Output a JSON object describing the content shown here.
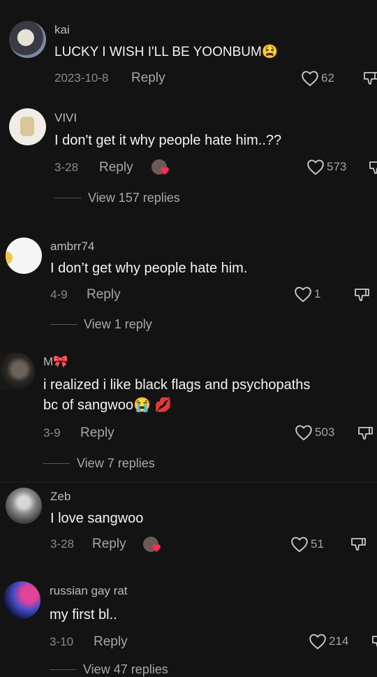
{
  "comments": [
    {
      "username": "kai",
      "text": "LUCKY I WISH I'LL BE YOONBUM",
      "emoji": "😫",
      "date": "2023-10-8",
      "reply": "Reply",
      "likes": "62"
    },
    {
      "username": "VIVI",
      "text": "I don't get it why people hate him..??",
      "date": "3-28",
      "reply": "Reply",
      "likes": "573",
      "view_replies": "View 157 replies"
    },
    {
      "username": "ambrr74",
      "text": "I don’t get why people hate him.",
      "date": "4-9",
      "reply": "Reply",
      "likes": "1",
      "view_replies": "View 1 reply"
    },
    {
      "username": "M🎀",
      "text_line1": "i realized i like black flags and psychopaths",
      "text_line2": "bc of sangwoo😭 💋",
      "date": "3-9",
      "reply": "Reply",
      "likes": "503",
      "view_replies": "View 7 replies"
    },
    {
      "username": "Zeb",
      "text": "I love sangwoo",
      "date": "3-28",
      "reply": "Reply",
      "likes": "51"
    },
    {
      "username": "russian gay rat",
      "text": "my first bl..",
      "date": "3-10",
      "reply": "Reply",
      "likes": "214",
      "view_replies": "View 47 replies"
    }
  ]
}
